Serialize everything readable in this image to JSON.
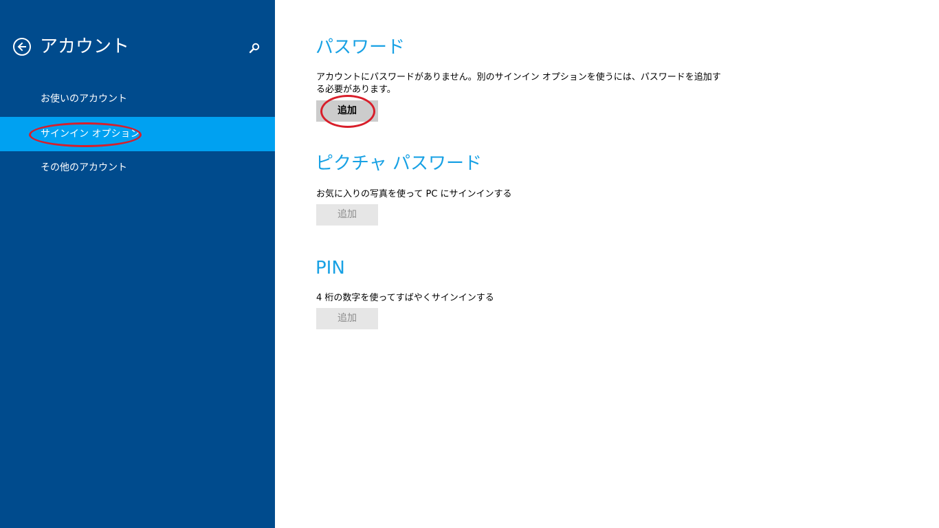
{
  "sidebar": {
    "title": "アカウント",
    "back_icon": "back-arrow-icon",
    "search_icon": "search-icon",
    "items": [
      {
        "label": "お使いのアカウント",
        "selected": false
      },
      {
        "label": "サインイン オプション",
        "selected": true
      },
      {
        "label": "その他のアカウント",
        "selected": false
      }
    ]
  },
  "sections": {
    "password": {
      "heading": "パスワード",
      "description": "アカウントにパスワードがありません。別のサインイン オプションを使うには、パスワードを追加する必要があります。",
      "button_label": "追加",
      "button_enabled": true
    },
    "picture_password": {
      "heading": "ピクチャ パスワード",
      "description": "お気に入りの写真を使って PC にサインインする",
      "button_label": "追加",
      "button_enabled": false
    },
    "pin": {
      "heading": "PIN",
      "description": "4 桁の数字を使ってすばやくサインインする",
      "button_label": "追加",
      "button_enabled": false
    }
  },
  "colors": {
    "sidebar_bg": "#004b8d",
    "selected_item_bg": "#00a1f1",
    "heading": "#18a1e4",
    "annotation": "#d81e2a"
  }
}
